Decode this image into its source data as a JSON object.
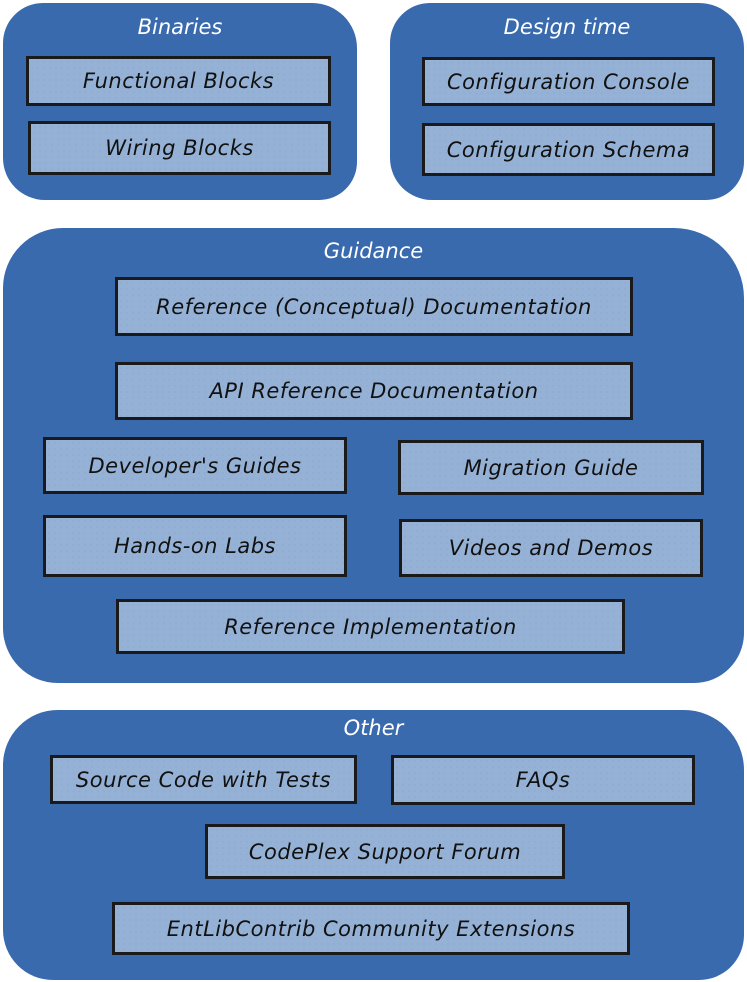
{
  "groups": {
    "binaries": {
      "title": "Binaries",
      "items": [
        "Functional Blocks",
        "Wiring Blocks"
      ]
    },
    "design_time": {
      "title": "Design time",
      "items": [
        "Configuration Console",
        "Configuration Schema"
      ]
    },
    "guidance": {
      "title": "Guidance",
      "items": [
        "Reference (Conceptual) Documentation",
        "API Reference Documentation",
        "Developer's Guides",
        "Migration Guide",
        "Hands-on Labs",
        "Videos and Demos",
        "Reference Implementation"
      ]
    },
    "other": {
      "title": "Other",
      "items": [
        "Source Code with Tests",
        "FAQs",
        "CodePlex Support Forum",
        "EntLibContrib Community Extensions"
      ]
    }
  },
  "colors": {
    "group_fill": "#3a6aae",
    "box_fill": "#95b2d6",
    "box_border": "#1a1a1a"
  }
}
